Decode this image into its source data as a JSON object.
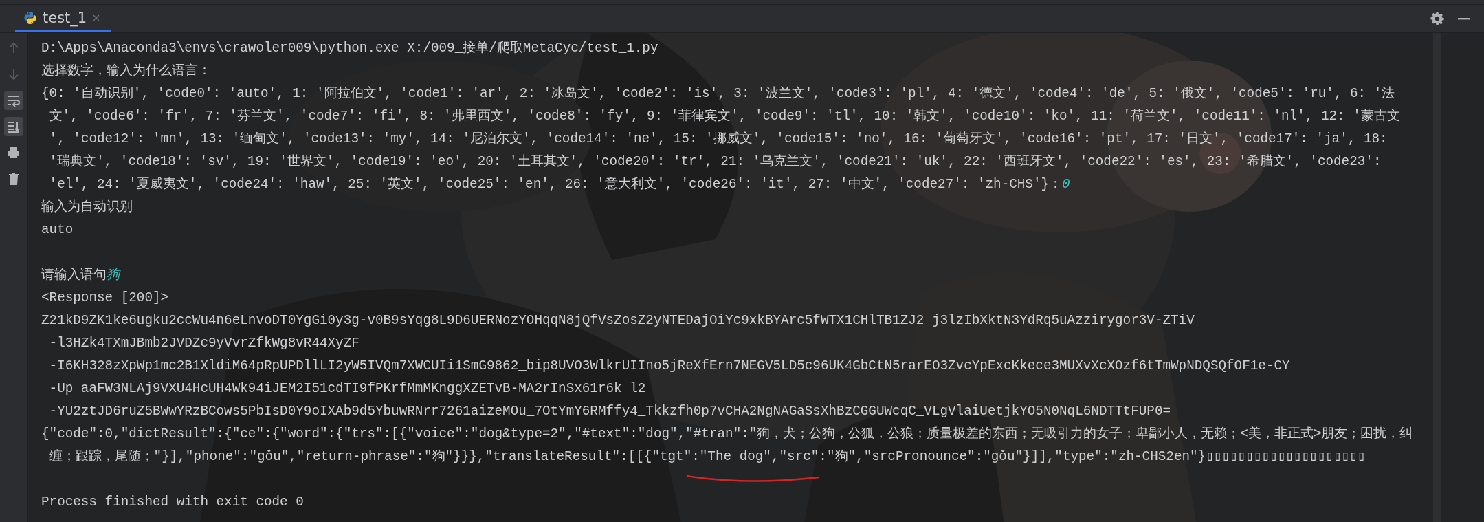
{
  "tabs": [
    {
      "label": "test_1",
      "selected": true
    }
  ],
  "toolbar": [
    {
      "kind": "up",
      "disabled": true,
      "on": false
    },
    {
      "kind": "down",
      "disabled": true,
      "on": false
    },
    {
      "kind": "wrap",
      "disabled": false,
      "on": true
    },
    {
      "kind": "scroll-end",
      "disabled": false,
      "on": true
    },
    {
      "kind": "print",
      "disabled": false,
      "on": false
    },
    {
      "kind": "trash",
      "disabled": false,
      "on": false
    }
  ],
  "console": [
    {
      "lines": [
        {
          "text": "D:\\Apps\\Anaconda3\\envs\\crawoler009\\python.exe X:/009_接单/爬取MetaCyc/test_1.py"
        },
        {
          "text": "选择数字，输入为什么语言："
        },
        {
          "text": "{0: '自动识别', 'code0': 'auto', 1: '阿拉伯文', 'code1': 'ar', 2: '冰岛文', 'code2': 'is', 3: '波兰文', 'code3': 'pl', 4: '德文', 'code4': 'de', 5: '俄文', 'code5': 'ru', 6: '法"
        },
        {
          "text": " 文', 'code6': 'fr', 7: '芬兰文', 'code7': 'fi', 8: '弗里西文', 'code8': 'fy', 9: '菲律宾文', 'code9': 'tl', 10: '韩文', 'code10': 'ko', 11: '荷兰文', 'code11': 'nl', 12: '蒙古文"
        },
        {
          "text": " ', 'code12': 'mn', 13: '缅甸文', 'code13': 'my', 14: '尼泊尔文', 'code14': 'ne', 15: '挪威文', 'code15': 'no', 16: '葡萄牙文', 'code16': 'pt', 17: '日文', 'code17': 'ja', 18:"
        },
        {
          "text": " '瑞典文', 'code18': 'sv', 19: '世界文', 'code19': 'eo', 20: '土耳其文', 'code20': 'tr', 21: '乌克兰文', 'code21': 'uk', 22: '西班牙文', 'code22': 'es', 23: '希腊文', 'code23':"
        },
        {
          "text": " 'el', 24: '夏威夷文', 'code24': 'haw', 25: '英文', 'code25': 'en', 26: '意大利文', 'code26': 'it', 27: '中文', 'code27': 'zh-CHS'}：",
          "input": "0"
        },
        {
          "text": "输入为自动识别"
        },
        {
          "text": "auto"
        }
      ]
    },
    {
      "lines": [
        {
          "text": "请输入语句",
          "input": "狗"
        },
        {
          "text": "<Response [200]>"
        },
        {
          "text": "Z21kD9ZK1ke6ugku2ccWu4n6eLnvoDT0YgGi0y3g-v0B9sYqg8L9D6UERNozYOHqqN8jQfVsZosZ2yNTEDajOiYc9xkBYArc5fWTX1CHlTB1ZJ2_j3lzIbXktN3YdRq5uAzzirygor3V-ZTiV"
        },
        {
          "text": " -l3HZk4TXmJBmb2JVDZc9yVvrZfkWg8vR44XyZF"
        },
        {
          "text": " -I6KH328zXpWp1mc2B1XldiM64pRpUPDllLI2yW5IVQm7XWCUIi1SmG9862_bip8UVO3WlkrUIIno5jReXfErn7NEGV5LD5c96UK4GbCtN5rarEO3ZvcYpExcKkece3MUXvXcXOzf6tTmWpNDQSQfOF1e-CY"
        },
        {
          "text": " -Up_aaFW3NLAj9VXU4HcUH4Wk94iJEM2I51cdTI9fPKrfMmMKnggXZETvB-MA2rInSx61r6k_l2"
        },
        {
          "text": " -YU2ztJD6ruZ5BWwYRzBCows5PbIsD0Y9oIXAb9d5YbuwRNrr7261aizeMOu_7OtYmY6RMffy4_Tkkzfh0p7vCHA2NgNAGaSsXhBzCGGUWcqC_VLgVlaiUetjkYO5N0NqL6NDTTtFUP0="
        },
        {
          "text": "{\"code\":0,\"dictResult\":{\"ce\":{\"word\":{\"trs\":[{\"voice\":\"dog&type=2\",\"#text\":\"dog\",\"#tran\":\"狗，犬；公狗，公狐，公狼；质量极差的东西；无吸引力的女子；卑鄙小人，无赖；<美，非正式>朋友；困扰，纠"
        },
        {
          "text": " 缠；跟踪，尾随；\"}],\"phone\":\"gǒu\",\"return-phrase\":\"狗\"}}},\"translateResult\":[[{\"tgt\":\"The dog\",\"src\":\"狗\",\"srcPronounce\":\"gǒu\"}]],\"type\":\"zh-CHS2en\"}▯▯▯▯▯▯▯▯▯▯▯▯▯▯▯▯▯▯▯▯"
        }
      ]
    },
    {
      "lines": [
        {
          "text": "Process finished with exit code 0"
        }
      ]
    }
  ]
}
